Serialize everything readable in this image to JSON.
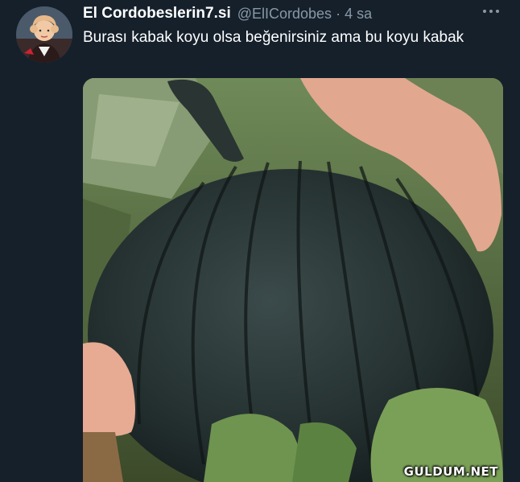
{
  "tweet": {
    "display_name": "El Cordobeslerin7.si",
    "handle": "@ElICordobes",
    "separator": "·",
    "time": "4 sa",
    "text": "Burası kabak koyu olsa beğenirsiniz ama bu koyu kabak",
    "more_icon": "more-horizontal-icon"
  },
  "media": {
    "description_icon": "dark-pumpkin-photo",
    "watermark": "GULDUM.NET"
  },
  "colors": {
    "background": "#15202b",
    "secondary_text": "#8899a6",
    "primary_text": "#ffffff"
  }
}
